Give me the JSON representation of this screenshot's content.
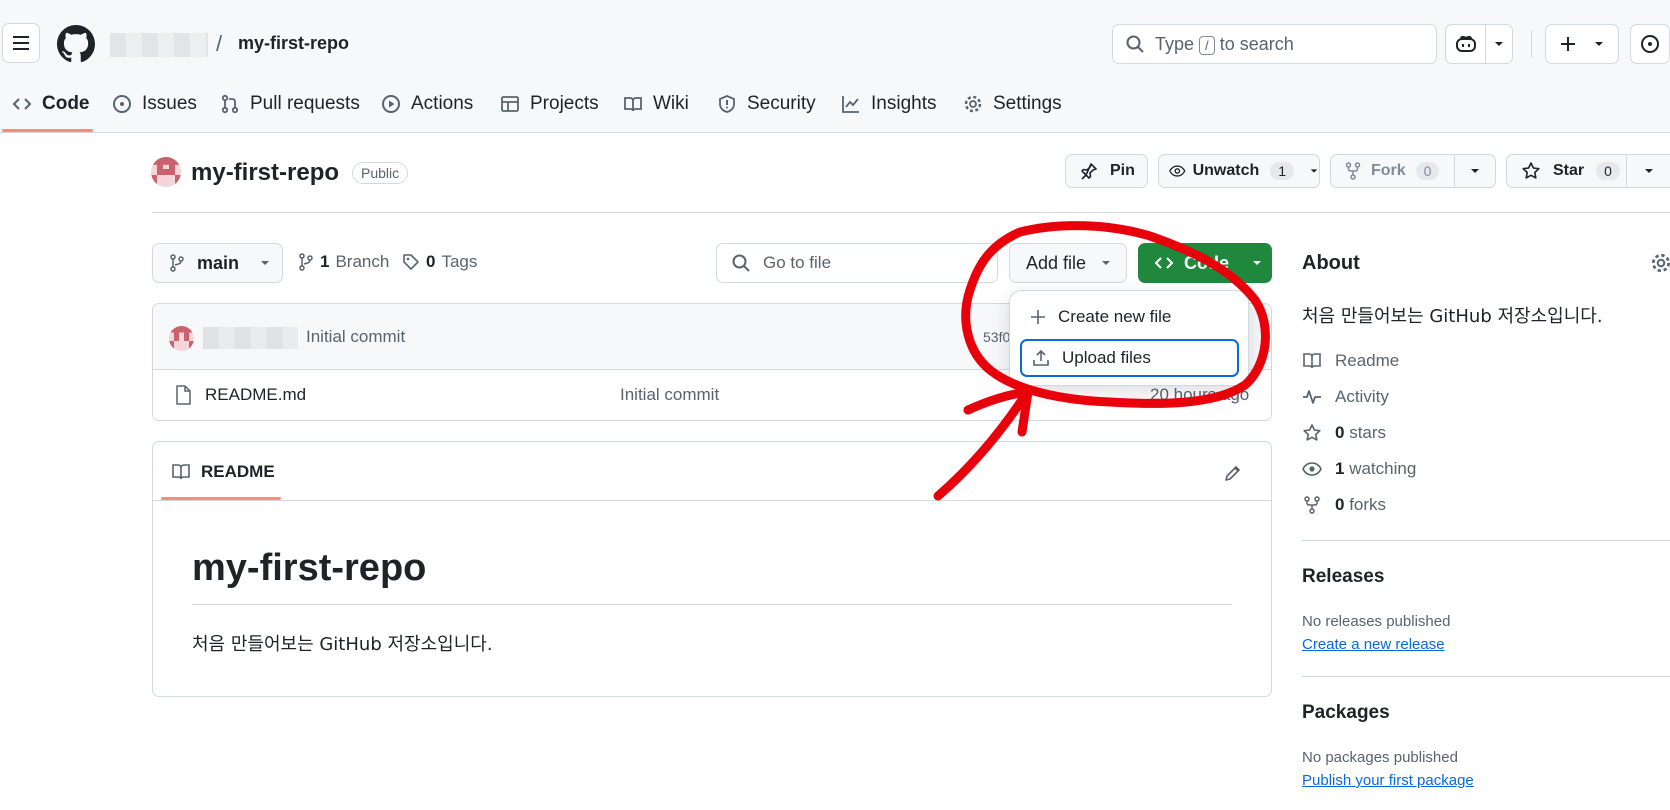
{
  "header": {
    "owner": "",
    "separator": "/",
    "repo": "my-first-repo",
    "search_prefix": "Type",
    "search_key": "/",
    "search_suffix": "to search"
  },
  "nav": {
    "tabs": [
      {
        "label": "Code",
        "icon": "code-icon"
      },
      {
        "label": "Issues",
        "icon": "issue-icon"
      },
      {
        "label": "Pull requests",
        "icon": "pull-request-icon"
      },
      {
        "label": "Actions",
        "icon": "play-icon"
      },
      {
        "label": "Projects",
        "icon": "table-icon"
      },
      {
        "label": "Wiki",
        "icon": "book-icon"
      },
      {
        "label": "Security",
        "icon": "shield-icon"
      },
      {
        "label": "Insights",
        "icon": "graph-icon"
      },
      {
        "label": "Settings",
        "icon": "gear-icon"
      }
    ]
  },
  "repo": {
    "title": "my-first-repo",
    "visibility": "Public",
    "pin": "Pin",
    "unwatch": "Unwatch",
    "watch_count": "1",
    "fork": "Fork",
    "fork_count": "0",
    "star": "Star",
    "star_count": "0"
  },
  "toolbar": {
    "branch": "main",
    "branches_count": "1",
    "branches_label": "Branch",
    "tags_count": "0",
    "tags_label": "Tags",
    "goto_placeholder": "Go to file",
    "add_file": "Add file",
    "code": "Code"
  },
  "dropdown": {
    "items": [
      "Create new file",
      "Upload files"
    ]
  },
  "commit": {
    "message": "Initial commit",
    "hash_partial": "53f0"
  },
  "files": [
    {
      "name": "README.md",
      "message": "Initial commit",
      "age": "20 hours ago"
    }
  ],
  "readme": {
    "tab": "README",
    "heading": "my-first-repo",
    "body": "처음 만들어보는 GitHub 저장소입니다."
  },
  "about": {
    "title": "About",
    "description": "처음 만들어보는 GitHub 저장소입니다.",
    "readme": "Readme",
    "activity": "Activity",
    "stars_count": "0",
    "stars_label": "stars",
    "watching_count": "1",
    "watching_label": "watching",
    "forks_count": "0",
    "forks_label": "forks"
  },
  "releases": {
    "title": "Releases",
    "empty": "No releases published",
    "link": "Create a new release"
  },
  "packages": {
    "title": "Packages",
    "empty": "No packages published",
    "link": "Publish your first package"
  },
  "colors": {
    "accent_tab": "#fd8c73",
    "code_button": "#1f883d",
    "focus": "#0969da",
    "annotation": "#e8000b"
  }
}
